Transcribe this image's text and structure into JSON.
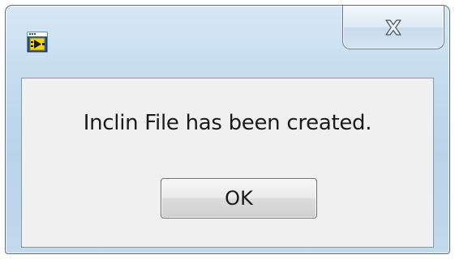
{
  "dialog": {
    "app_icon": "labview-vi-icon",
    "close_icon": "close-icon",
    "message": "Inclin File has been created.",
    "ok_label": "OK"
  }
}
